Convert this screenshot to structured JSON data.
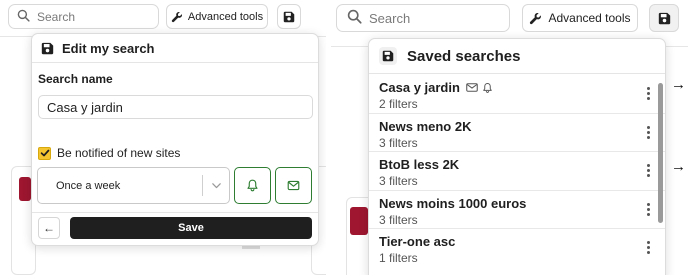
{
  "left": {
    "search": {
      "placeholder": "Search"
    },
    "advanced_tools_label": "Advanced tools",
    "edit_popup": {
      "title": "Edit my search",
      "search_name_label": "Search name",
      "search_name_value": "Casa y jardin",
      "notify_label": "Be notified of new sites",
      "notify_checked": true,
      "frequency_value": "Once a week",
      "save_label": "Save",
      "back_label": "←"
    }
  },
  "right": {
    "search": {
      "placeholder": "Search"
    },
    "advanced_tools_label": "Advanced tools",
    "saved_panel": {
      "title": "Saved searches",
      "items": [
        {
          "name": "Casa y jardin",
          "filters": "2 filters",
          "icons": [
            "mail-icon",
            "bell-icon"
          ]
        },
        {
          "name": "News meno 2K",
          "filters": "3 filters"
        },
        {
          "name": "BtoB less 2K",
          "filters": "3 filters"
        },
        {
          "name": "News moins 1000 euros",
          "filters": "3 filters"
        },
        {
          "name": "Tier-one asc",
          "filters": "1 filters"
        }
      ]
    },
    "arrow_glyph": "→"
  },
  "colors": {
    "accent_green": "#2e7d32",
    "checkbox_yellow": "#f4c52e",
    "save_button_bg": "#1f1f1f",
    "brand_red": "#9e1630"
  }
}
